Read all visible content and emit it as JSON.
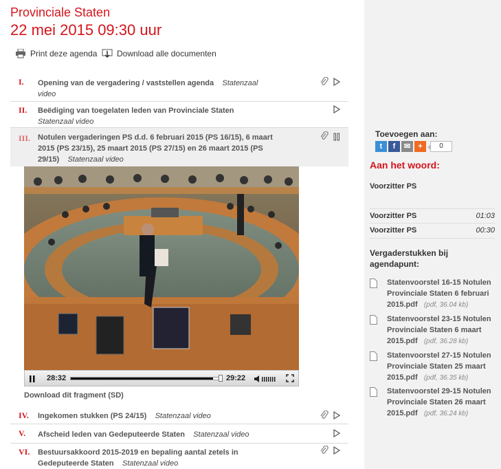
{
  "header": {
    "title": "Provinciale Staten",
    "datetime": "22 mei 2015 09:30 uur"
  },
  "toolbar": {
    "print_label": "Print deze agenda",
    "download_label": "Download alle documenten"
  },
  "agenda": [
    {
      "num": "I.",
      "line1": "Opening van de vergadering / vaststellen agenda",
      "loc": "Statenzaal",
      "line2": "video"
    },
    {
      "num": "II.",
      "line1": "Beëdiging van toegelaten leden van Provinciale Staten",
      "loc2": "Statenzaal video"
    },
    {
      "num": "III.",
      "line1": "Notulen vergaderingen PS d.d. 6 februari 2015 (PS 16/15), 6 maart",
      "line2": "2015 (PS 23/15), 25 maart 2015 (PS 27/15) en 26 maart 2015 (PS",
      "line3": "29/15)",
      "loc": "Statenzaal video"
    },
    {
      "num": "IV.",
      "line1": "Ingekomen stukken (PS 24/15)",
      "loc": "Statenzaal video"
    },
    {
      "num": "V.",
      "line1": "Afscheid leden van Gedeputeerde Staten",
      "loc": "Statenzaal video"
    },
    {
      "num": "VI.",
      "line1": "Bestuursakkoord 2015-2019 en bepaling aantal zetels in",
      "line2": "Gedeputeerde Staten",
      "loc": "Statenzaal video"
    }
  ],
  "player": {
    "elapsed": "28:32",
    "duration": "29:22",
    "progress": 0.96
  },
  "download_fragment": "Download dit fragment (SD)",
  "sidebar": {
    "share_label": "Toevoegen aan:",
    "share_count": "0",
    "speakers_title": "Aan het woord:",
    "current_speaker": "Voorzitter PS",
    "speakers": [
      {
        "name": "Voorzitter PS",
        "time": "01:03"
      },
      {
        "name": "Voorzitter PS",
        "time": "00:30"
      }
    ],
    "docs_title_1": "Vergaderstukken bij",
    "docs_title_2": "agendapunt:",
    "docs": [
      {
        "l1": "Statenvoorstel 16-15 Notulen",
        "l2": "Provinciale Staten 6 februari",
        "l3": "2015.pdf",
        "meta": "(pdf, 36.04 kb)"
      },
      {
        "l1": "Statenvoorstel 23-15 Notulen",
        "l2": "Provinciale Staten 6 maart",
        "l3": "2015.pdf",
        "meta": "(pdf, 36.28 kb)"
      },
      {
        "l1": "Statenvoorstel 27-15 Notulen",
        "l2": "Provinciale Staten 25 maart",
        "l3": "2015.pdf",
        "meta": "(pdf, 36.35 kb)"
      },
      {
        "l1": "Statenvoorstel 29-15 Notulen",
        "l2": "Provinciale Staten 26 maart",
        "l3": "2015.pdf",
        "meta": "(pdf, 36.24 kb)"
      }
    ]
  },
  "colors": {
    "accent": "#d4151c",
    "sidebar_bg": "#f2f2f2"
  }
}
